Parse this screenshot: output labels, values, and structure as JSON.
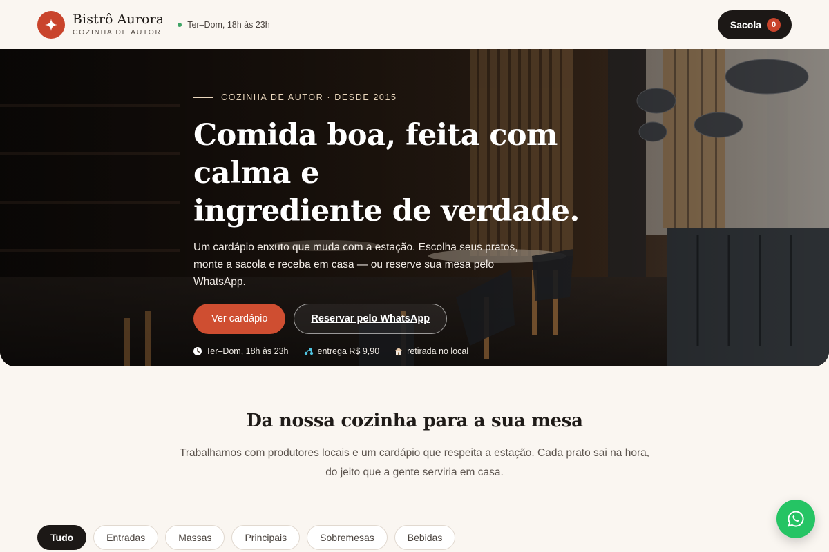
{
  "header": {
    "brand_name": "Bistrô Aurora",
    "brand_tagline": "COZINHA DE AUTOR",
    "hours": "Ter–Dom, 18h às 23h",
    "bag_label": "Sacola",
    "bag_count": "0"
  },
  "hero": {
    "eyebrow": "COZINHA DE AUTOR · DESDE 2015",
    "title_line1": "Comida boa, feita com calma e",
    "title_line2": "ingrediente de verdade.",
    "description": "Um cardápio enxuto que muda com a estação. Escolha seus pratos, monte a sacola e receba em casa — ou reserve sua mesa pelo WhatsApp.",
    "primary_cta": "Ver cardápio",
    "secondary_cta": "Reservar pelo WhatsApp",
    "meta": {
      "hours": "Ter–Dom, 18h às 23h",
      "delivery": "entrega R$ 9,90",
      "pickup": "retirada no local"
    }
  },
  "intro": {
    "title": "Da nossa cozinha para a sua mesa",
    "text": "Trabalhamos com produtores locais e um cardápio que respeita a estação. Cada prato sai na hora, do jeito que a gente serviria em casa."
  },
  "filters": [
    "Tudo",
    "Entradas",
    "Massas",
    "Principais",
    "Sobremesas",
    "Bebidas"
  ],
  "colors": {
    "accent": "#c9442c",
    "dark": "#1c1816",
    "background": "#faf6f1",
    "whatsapp": "#25c464"
  },
  "icons": {
    "logo": "sparkle-icon",
    "hours": "clock-icon",
    "delivery": "scooter-icon",
    "pickup": "store-icon",
    "fab": "whatsapp-icon"
  }
}
